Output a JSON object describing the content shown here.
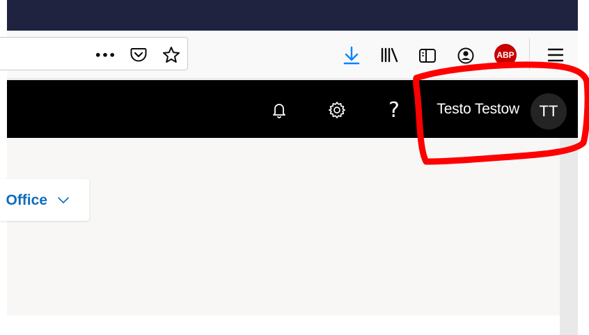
{
  "toolbar": {
    "icons": [
      "more-icon",
      "pocket-icon",
      "bookmark-star-icon",
      "download-icon",
      "library-icon",
      "sidebar-icon",
      "account-icon",
      "adblock-icon",
      "menu-icon"
    ],
    "more_label": "•••",
    "adblock_label": "ABP",
    "download_color": "#0a84ff",
    "adblock_color": "#c80000"
  },
  "header": {
    "icons": [
      "bell-icon",
      "gear-icon",
      "help-icon"
    ],
    "help_label": "?",
    "user_name": "Testo Testow",
    "avatar_initials": "TT"
  },
  "main": {
    "card_label": "Office"
  },
  "colors": {
    "titlebar": "#202340",
    "header_bg": "#000000",
    "content_bg": "#f8f7f6",
    "link_blue": "#0f6cbd",
    "annotation_red": "#ff0000"
  }
}
